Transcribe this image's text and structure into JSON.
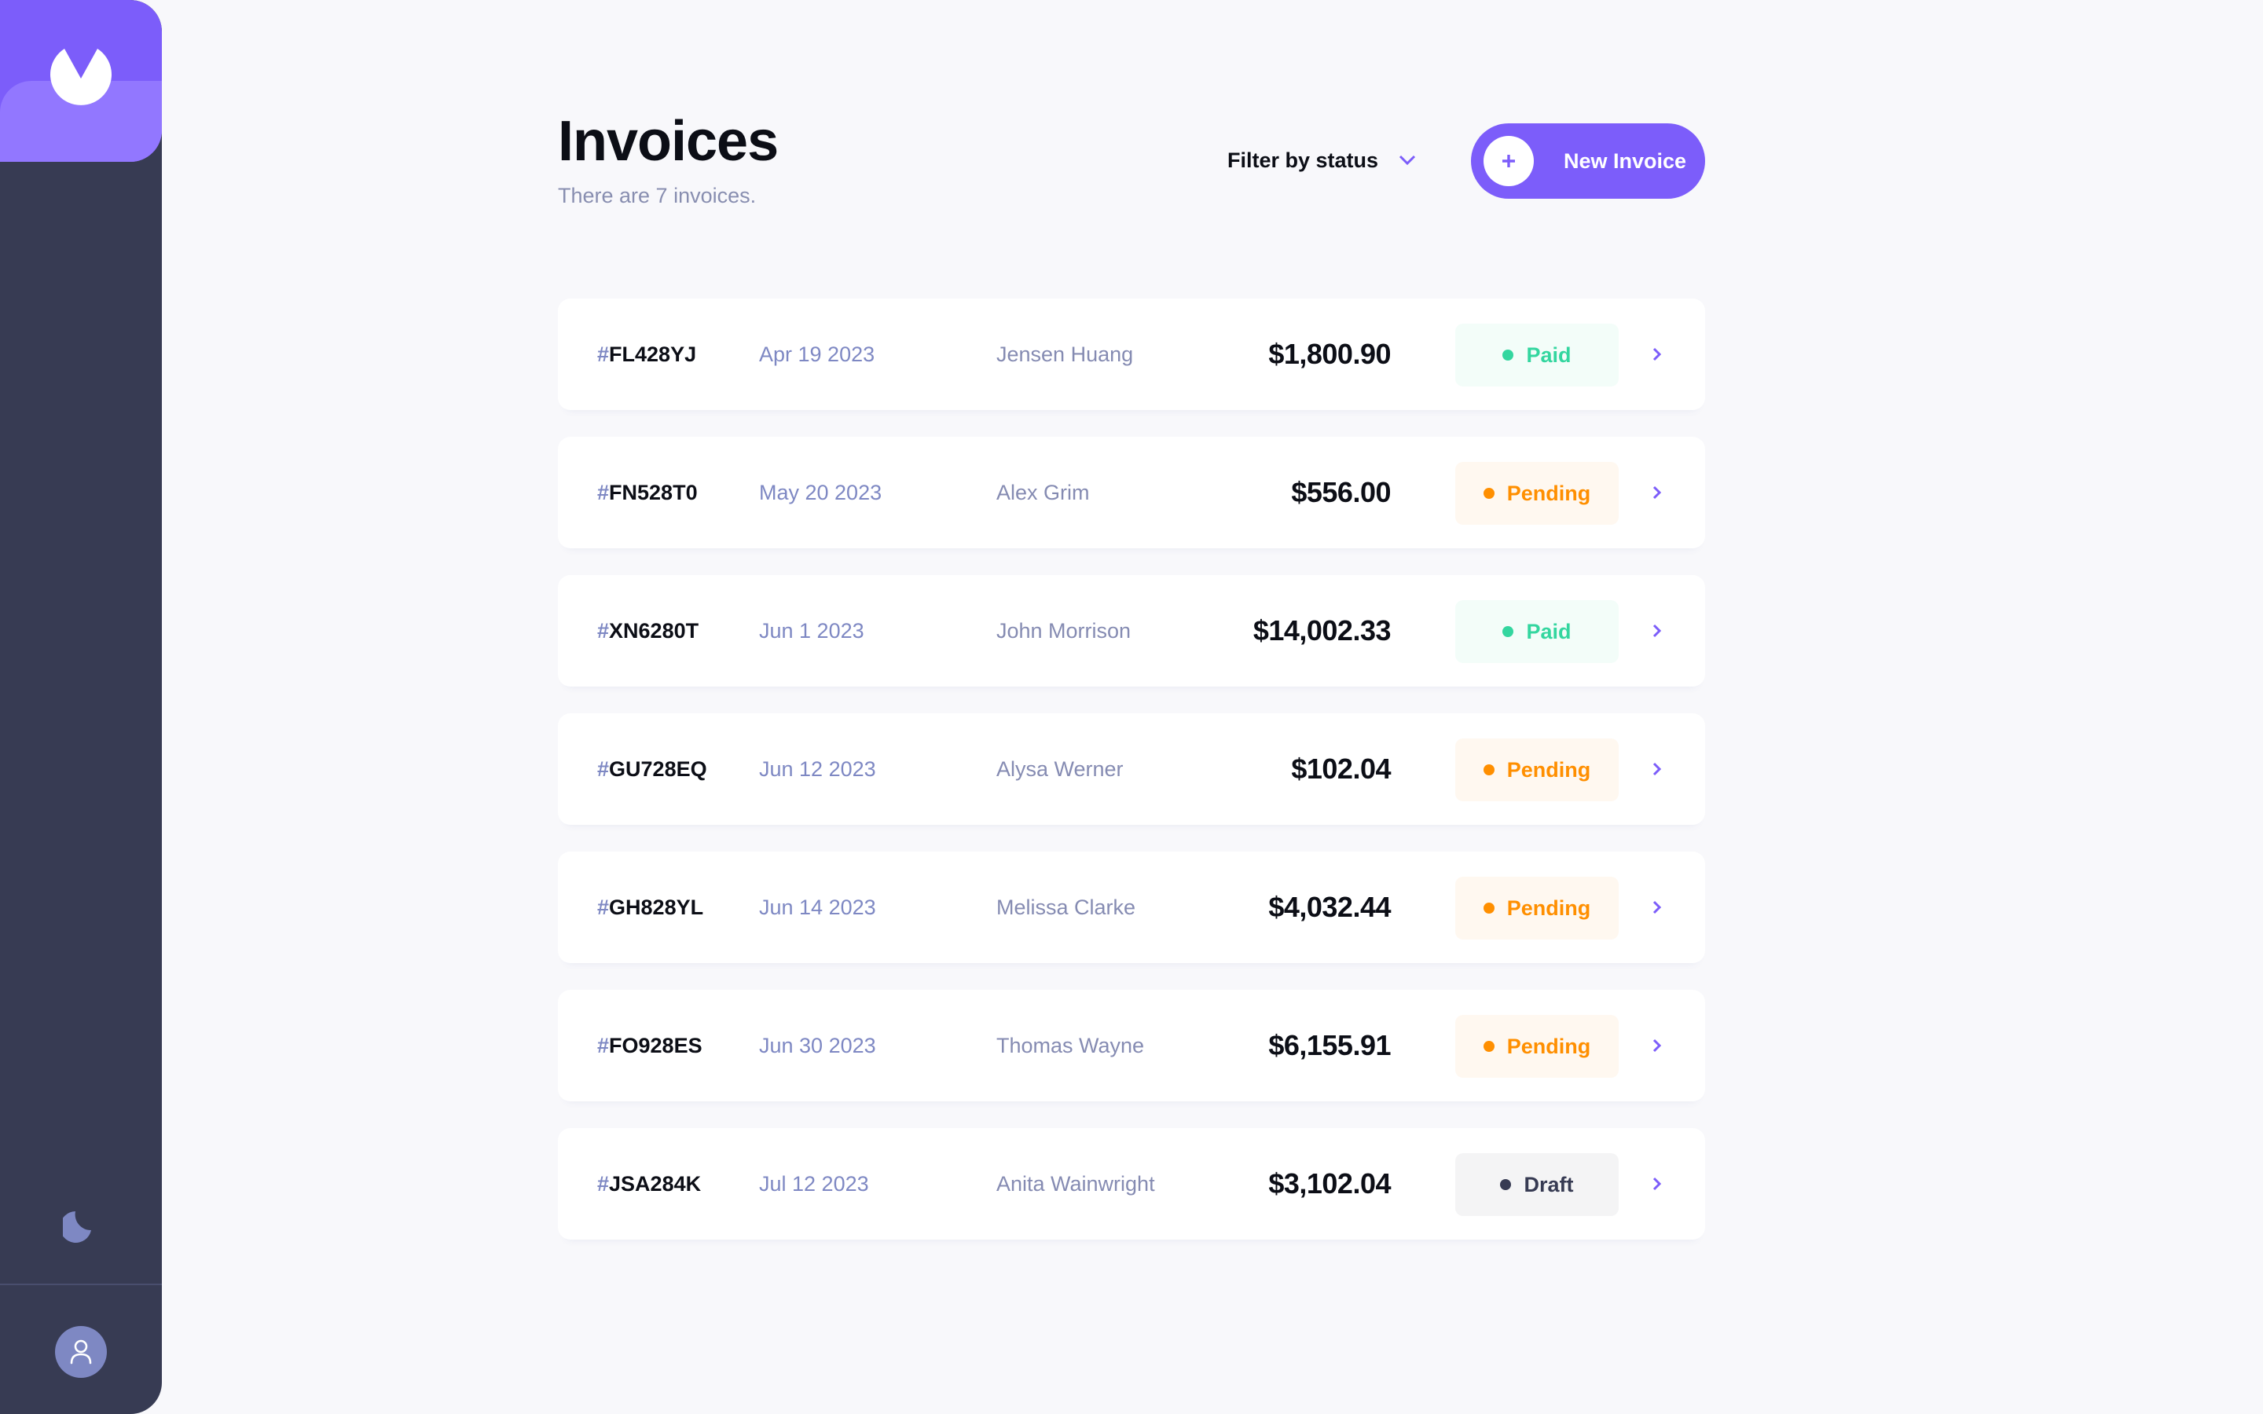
{
  "app": {
    "logo_icon": "app-logo-icon",
    "theme_icon": "moon-icon",
    "avatar_icon": "user-icon"
  },
  "header": {
    "title": "Invoices",
    "subtitle": "There are 7 invoices.",
    "filter_label": "Filter by status",
    "filter_icon": "chevron-down-icon",
    "new_button_label": "New Invoice",
    "new_button_icon": "plus-icon"
  },
  "colors": {
    "accent": "#7C5DFA",
    "accent_light": "#9277FF",
    "sidebar": "#373B53",
    "paid": "#33D69F",
    "pending": "#FF8F00",
    "draft": "#373B53"
  },
  "invoices": [
    {
      "hash": "#",
      "id": "FL428YJ",
      "date": "Apr 19 2023",
      "client": "Jensen Huang",
      "amount": "$1,800.90",
      "status": "Paid",
      "status_key": "paid"
    },
    {
      "hash": "#",
      "id": "FN528T0",
      "date": "May 20 2023",
      "client": "Alex Grim",
      "amount": "$556.00",
      "status": "Pending",
      "status_key": "pending"
    },
    {
      "hash": "#",
      "id": "XN6280T",
      "date": "Jun 1 2023",
      "client": "John Morrison",
      "amount": "$14,002.33",
      "status": "Paid",
      "status_key": "paid"
    },
    {
      "hash": "#",
      "id": "GU728EQ",
      "date": "Jun 12 2023",
      "client": "Alysa Werner",
      "amount": "$102.04",
      "status": "Pending",
      "status_key": "pending"
    },
    {
      "hash": "#",
      "id": "GH828YL",
      "date": "Jun 14 2023",
      "client": "Melissa Clarke",
      "amount": "$4,032.44",
      "status": "Pending",
      "status_key": "pending"
    },
    {
      "hash": "#",
      "id": "FO928ES",
      "date": "Jun 30 2023",
      "client": "Thomas Wayne",
      "amount": "$6,155.91",
      "status": "Pending",
      "status_key": "pending"
    },
    {
      "hash": "#",
      "id": "JSA284K",
      "date": "Jul 12 2023",
      "client": "Anita Wainwright",
      "amount": "$3,102.04",
      "status": "Draft",
      "status_key": "draft"
    }
  ]
}
